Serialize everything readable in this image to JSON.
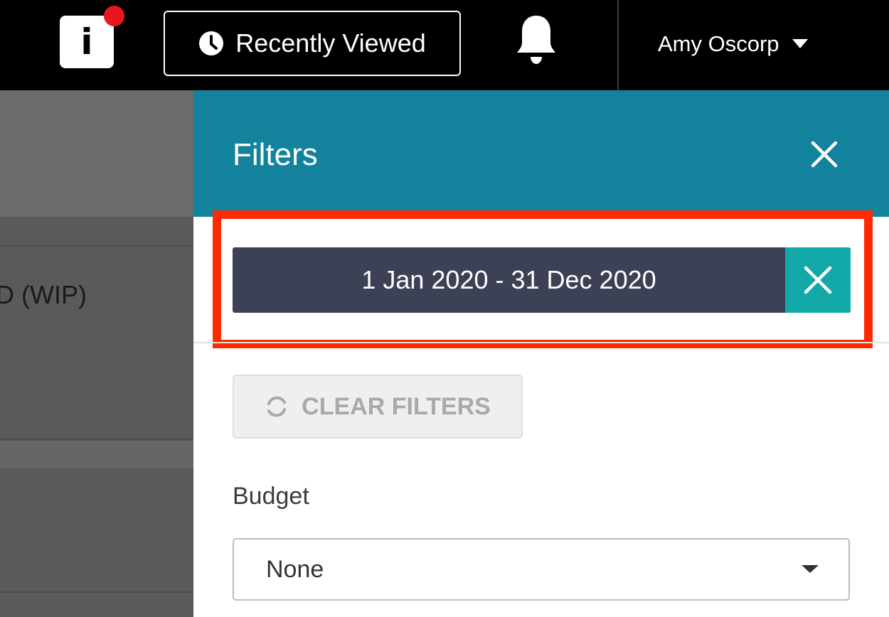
{
  "topbar": {
    "logo_letter": "i",
    "recently_viewed_label": "Recently Viewed",
    "user_name": "Amy Oscorp",
    "icons": {
      "logo": "info-icon",
      "notification": "notification-dot",
      "recent": "clock-icon",
      "bell": "bell-icon",
      "user_menu": "caret-down-icon"
    }
  },
  "background": {
    "partial_text": "D (WIP)"
  },
  "filters_panel": {
    "title": "Filters",
    "active_filter_label": "1 Jan 2020 - 31 Dec 2020",
    "clear_filters_label": "CLEAR FILTERS",
    "budget": {
      "label": "Budget",
      "selected": "None"
    }
  },
  "colors": {
    "topbar_bg": "#000000",
    "panel_header": "#13829c",
    "chip_bg": "#3d4156",
    "chip_remove_bg": "#13a8a8",
    "highlight": "#ff2a00",
    "notification": "#e8171e"
  }
}
